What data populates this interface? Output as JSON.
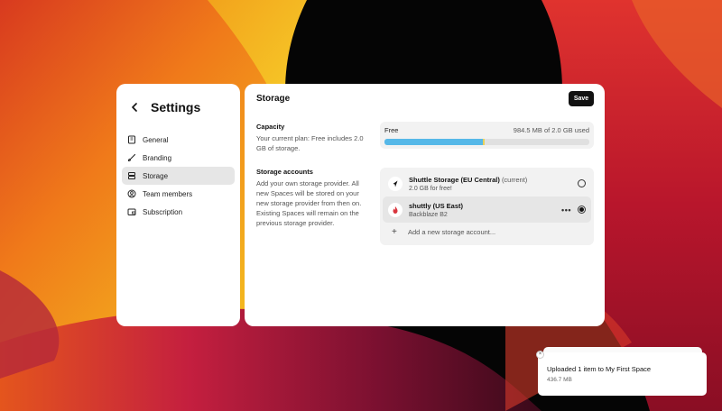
{
  "settings": {
    "title": "Settings",
    "nav": [
      {
        "label": "General",
        "icon": "building-icon"
      },
      {
        "label": "Branding",
        "icon": "brush-icon"
      },
      {
        "label": "Storage",
        "icon": "database-icon",
        "active": true
      },
      {
        "label": "Team members",
        "icon": "user-circle-icon"
      },
      {
        "label": "Subscription",
        "icon": "card-icon"
      }
    ]
  },
  "storage": {
    "title": "Storage",
    "save_label": "Save",
    "capacity": {
      "label": "Capacity",
      "desc": "Your current plan: Free includes 2.0 GB of storage.",
      "plan": "Free",
      "used_text": "984.5 MB of 2.0 GB used",
      "fraction": 0.49
    },
    "accounts": {
      "label": "Storage accounts",
      "desc": "Add your own storage provider. All new Spaces will be stored on your new storage provider from then on. Existing Spaces will remain on the previous storage provider.",
      "items": [
        {
          "name": "Shuttle Storage (EU Central)",
          "tag": "(current)",
          "sub": "2.0 GB for free!",
          "icon": "rocket-icon",
          "selected": false
        },
        {
          "name": "shuttly (US East)",
          "tag": "",
          "sub": "Backblaze B2",
          "icon": "flame-icon",
          "selected": true
        }
      ],
      "add_label": "Add a new storage account..."
    }
  },
  "toast": {
    "title": "Uploaded 1 item to My First Space",
    "sub": "436.7 MB",
    "close": "×"
  },
  "colors": {
    "bar_fill": "#56b8e8",
    "accent_red": "#d9363e"
  }
}
